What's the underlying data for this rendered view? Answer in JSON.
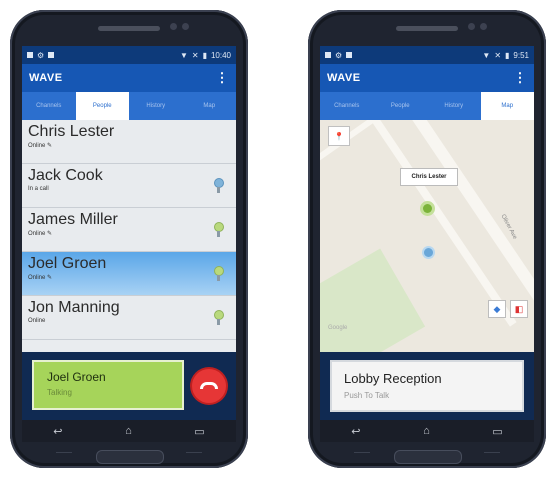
{
  "left_phone": {
    "status": {
      "time": "10:40"
    },
    "app_title": "WAVE",
    "menu_icon": "more-vert-icon",
    "tabs": [
      "Channels",
      "People",
      "History",
      "Map"
    ],
    "active_tab": "People",
    "contacts": [
      {
        "name": "Chris Lester",
        "status": "Online ✎",
        "pin": false,
        "pin_color": ""
      },
      {
        "name": "Jack Cook",
        "status": "In a call",
        "pin": true,
        "pin_color": "blue"
      },
      {
        "name": "James Miller",
        "status": "Online ✎",
        "pin": true,
        "pin_color": "green"
      },
      {
        "name": "Joel Groen",
        "status": "Online ✎",
        "pin": true,
        "pin_color": "green"
      },
      {
        "name": "Jon Manning",
        "status": "Online",
        "pin": true,
        "pin_color": "green"
      }
    ],
    "selected_contact": "Joel Groen",
    "call": {
      "name": "Joel Groen",
      "status": "Talking"
    },
    "nav": [
      "↩",
      "⌂",
      "▭"
    ]
  },
  "right_phone": {
    "status": {
      "time": "9:51"
    },
    "app_title": "WAVE",
    "menu_icon": "more-vert-icon",
    "tabs": [
      "Channels",
      "People",
      "History",
      "Map"
    ],
    "active_tab": "Map",
    "map": {
      "marker_label": "Chris Lester",
      "street_label": "Oliver Ave",
      "logo": "Google"
    },
    "channel": {
      "name": "Lobby Reception",
      "status": "Push To Talk"
    },
    "nav": [
      "↩",
      "⌂",
      "▭"
    ]
  },
  "colors": {
    "statusbar": "#0d3a7a",
    "appbar": "#1657b4",
    "tabs": "#2c6fce",
    "talking_card": "#a6d45a",
    "hangup": "#e63636",
    "selected_row": "#5aa6e8"
  }
}
